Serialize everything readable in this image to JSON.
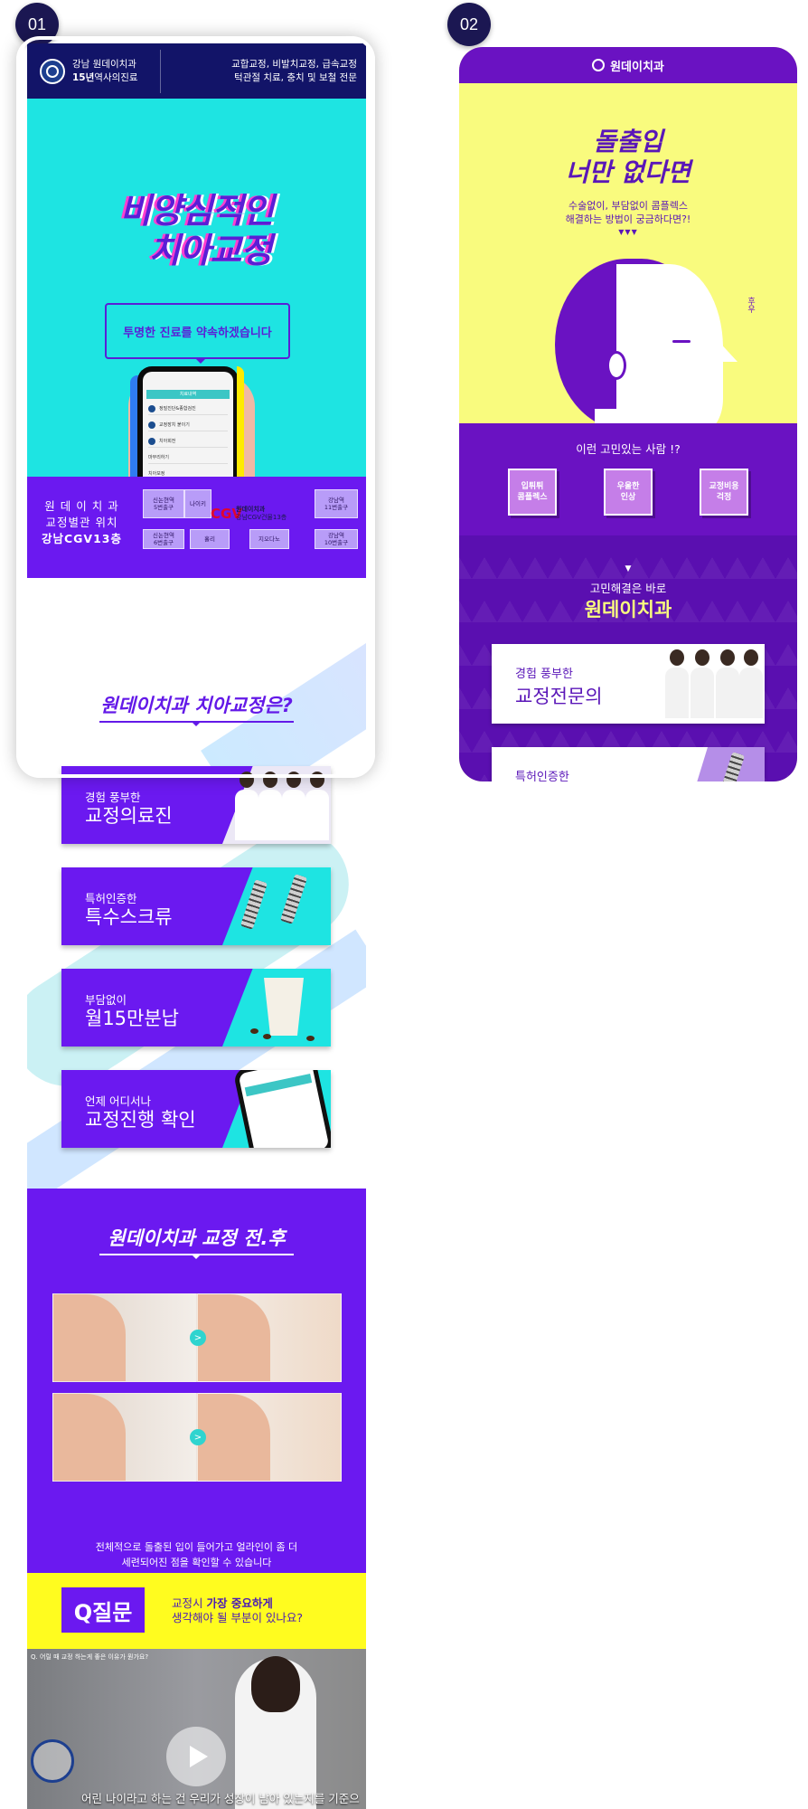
{
  "badges": [
    "01",
    "02"
  ],
  "p1": {
    "header": {
      "clinic": "강남 원데이치과",
      "years_bold": "15년",
      "years_rest": "역사의진료",
      "services_line1": "교합교정, 비발치교정, 급속교정",
      "services_line2": "턱관절 치료, 충치 및 보철 전문"
    },
    "hero": {
      "title_line1": "비양심적인",
      "title_line2": "치아교정",
      "promise": "투명한 진료를 약속하겠습니다",
      "phone_header": "치료내역",
      "phone_rows": [
        "정밀진단&종합검진",
        "교정장치 붙이기",
        "치아회전",
        "마무리하기",
        "치아보정"
      ]
    },
    "location": {
      "line1": "원 데 이 치 과",
      "line2": "교정별관 위치",
      "line3": "강남CGV13층",
      "cells": {
        "sinnonhyeon_5": "신논현역\n5번출구",
        "nike": "나이키",
        "gangnam_11": "강남역\n11번출구",
        "sinnonhyeon_6": "신논현역\n6번출구",
        "hollys": "홀리",
        "jiorudano": "지오다노",
        "gangnam_10": "강남역\n10번출구"
      },
      "cgv": "CGV",
      "clinic_tag": "원데이치과",
      "clinic_sub": "강남CGV건물13층"
    },
    "why": {
      "title": "원데이치과 치아교정은?",
      "cards": [
        {
          "small": "경험 풍부한",
          "big": "교정의료진"
        },
        {
          "small": "특허인증한",
          "big": "특수스크류"
        },
        {
          "small": "부담없이",
          "big": "월15만분납"
        },
        {
          "small": "언제 어디서나",
          "big": "교정진행 확인"
        }
      ]
    },
    "before_after": {
      "title": "원데이치과 교정 전.후",
      "caption_line1": "전체적으로 돌출된 입이 들어가고 얼라인이 좀 더",
      "caption_line2": "세련되어진 점을 확인할 수 있습니다"
    },
    "question": {
      "mark": "Q질문",
      "text_line1_prefix": "교정시 ",
      "text_line1_bold": "가장 중요하게",
      "text_line2": "생각해야 될 부분이 있나요?"
    },
    "video": {
      "question": "Q. 어릴 때 교정 하는게 좋은 이유가 뭔가요?",
      "subtitle": "어린 나이라고 하는 건 우리가 성장이 남아 있는지를 기준으로"
    }
  },
  "p2": {
    "header": {
      "clinic": "원데이치과"
    },
    "hero": {
      "title_line1": "돌출입",
      "title_line2": "너만 없다면",
      "sub_line1": "수술없이, 부담없이 콤플렉스",
      "sub_line2": "해결하는 방법이 궁금하다면?!",
      "triangles": "▼▼▼",
      "puff": "후우"
    },
    "who": {
      "title": "이런 고민있는 사람 !?",
      "chips": [
        "입튀튀\n콤플렉스",
        "우울한\n인상",
        "교정비용\n걱정"
      ]
    },
    "solve": {
      "arrow": "▼",
      "small": "고민해결은 바로",
      "big": "원데이치과",
      "cards": [
        {
          "small": "경험 풍부한",
          "big": "교정전문의"
        },
        {
          "small": "특허인증한",
          "big": ""
        }
      ]
    }
  },
  "colors": {
    "navy": "#121468",
    "purple": "#6b19f0",
    "cyan": "#1ee4e2",
    "yellow": "#fffc1f",
    "p2_purple": "#6a12c2",
    "p2_yellow": "#f9fb7e"
  }
}
